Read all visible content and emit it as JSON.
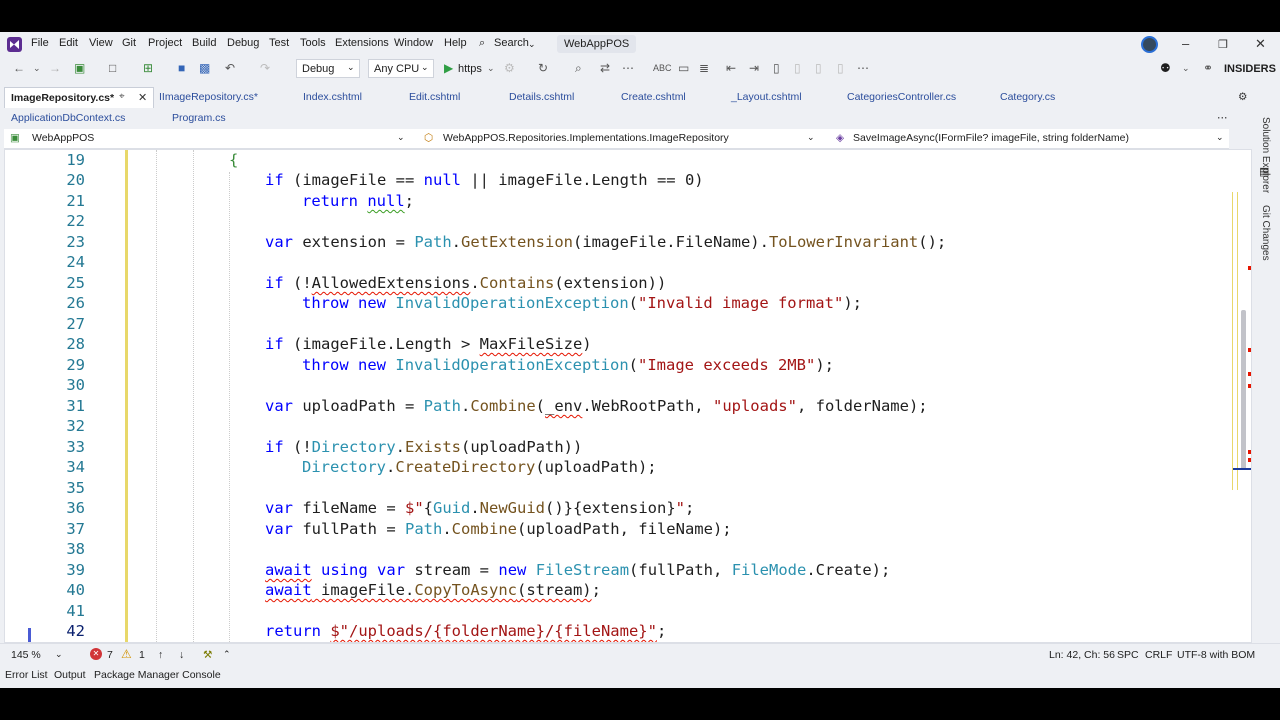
{
  "menu": {
    "items": [
      "File",
      "Edit",
      "View",
      "Git",
      "Project",
      "Build",
      "Debug",
      "Test",
      "Tools",
      "Extensions",
      "Window",
      "Help"
    ],
    "search": "Search",
    "solution": "WebAppPOS"
  },
  "toolbar": {
    "config": "Debug",
    "platform": "Any CPU",
    "run_target": "https",
    "insiders": "INSIDERS"
  },
  "tabs": {
    "row1": [
      "ImageRepository.cs*",
      "IImageRepository.cs*",
      "Index.cshtml",
      "Edit.cshtml",
      "Details.cshtml",
      "Create.cshtml",
      "_Layout.cshtml",
      "CategoriesController.cs",
      "Category.cs"
    ],
    "row2": [
      "ApplicationDbContext.cs",
      "Program.cs"
    ]
  },
  "navbar": {
    "project": "WebAppPOS",
    "type": "WebAppPOS.Repositories.Implementations.ImageRepository",
    "member": "SaveImageAsync(IFormFile? imageFile, string folderName)"
  },
  "side_panels": [
    "Solution Explorer",
    "Git Changes"
  ],
  "code": {
    "line_numbers": [
      "19",
      "20",
      "21",
      "22",
      "23",
      "24",
      "25",
      "26",
      "27",
      "28",
      "29",
      "30",
      "31",
      "32",
      "33",
      "34",
      "35",
      "36",
      "37",
      "38",
      "39",
      "40",
      "41",
      "42"
    ],
    "current_line": "42"
  },
  "status": {
    "zoom": "145 %",
    "errors": "7",
    "warnings": "1",
    "position": "Ln: 42, Ch: 56",
    "indent": "SPC",
    "line_ending": "CRLF",
    "encoding": "UTF-8 with BOM"
  },
  "bottom_tabs": [
    "Error List",
    "Output",
    "Package Manager Console"
  ],
  "colors": {
    "keyword": "#0000ff",
    "type": "#2b91af",
    "string": "#a31515",
    "method": "#74531f",
    "error_squiggle": "#e51400"
  }
}
